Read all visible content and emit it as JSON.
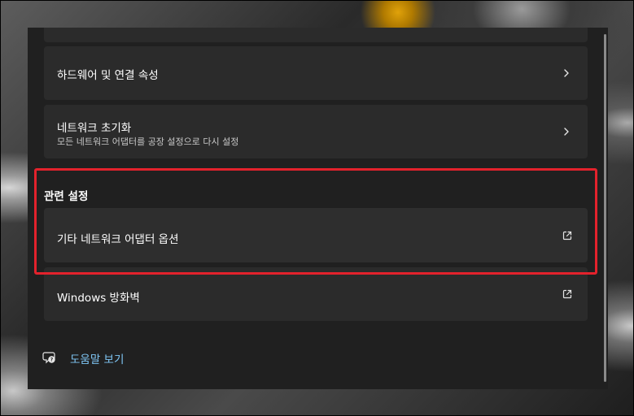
{
  "settings": {
    "items": [
      {
        "title": "하드웨어 및 연결 속성"
      },
      {
        "title": "네트워크 초기화",
        "subtitle": "모든 네트워크 어댑터를 공장 설정으로 다시 설정"
      }
    ]
  },
  "related": {
    "heading": "관련 설정",
    "items": [
      {
        "title": "기타 네트워크 어댑터 옵션"
      },
      {
        "title": "Windows 방화벽"
      }
    ]
  },
  "help": {
    "label": "도움말 보기"
  },
  "icons": {
    "chevron": "chevron-right-icon",
    "external": "open-external-icon",
    "help": "help-chat-icon"
  },
  "colors": {
    "highlight": "#e3222c",
    "link": "#7fc6f5",
    "panel": "#202020",
    "card": "#2b2b2b"
  }
}
